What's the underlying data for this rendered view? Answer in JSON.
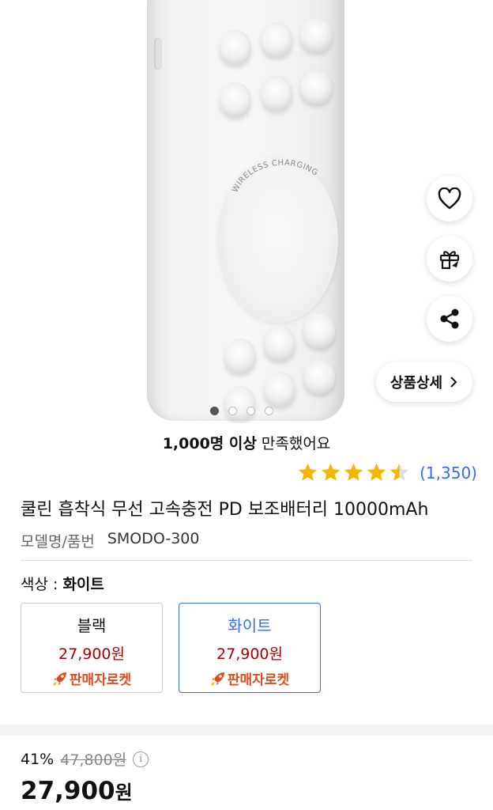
{
  "product_image": {
    "pad_text": "WIRELESS CHARGING",
    "total_images": 4,
    "active_index": 0
  },
  "actions": {
    "wishlist_icon": "heart-icon",
    "gift_icon": "gift-icon",
    "share_icon": "share-icon",
    "detail_label": "상품상세",
    "detail_icon": "chevron-right-icon"
  },
  "satisfaction": {
    "count": "1,000명 이상",
    "text": "만족했어요"
  },
  "rating": {
    "value": 4.5,
    "max": 5,
    "count": "(1,350)",
    "star_color": "#f7b500"
  },
  "product": {
    "title": "쿨린 흡착식 무선 고속충전 PD 보조배터리 10000mAh",
    "model_label": "모델명/품번",
    "model_value": "SMODO-300"
  },
  "color_option": {
    "label": "색상 :",
    "selected": "화이트",
    "options": [
      {
        "name": "블랙",
        "price": "27,900원",
        "badge": "판매자로켓",
        "selected": false
      },
      {
        "name": "화이트",
        "price": "27,900원",
        "badge": "판매자로켓",
        "selected": true
      }
    ]
  },
  "price": {
    "discount_rate": "41%",
    "original": "47,800원",
    "final": "27,900",
    "final_unit": "원",
    "info_icon": "info-icon"
  },
  "colors": {
    "accent": "#346aff",
    "price_red": "#ae0000",
    "rocket_orange": "#e4491b"
  }
}
